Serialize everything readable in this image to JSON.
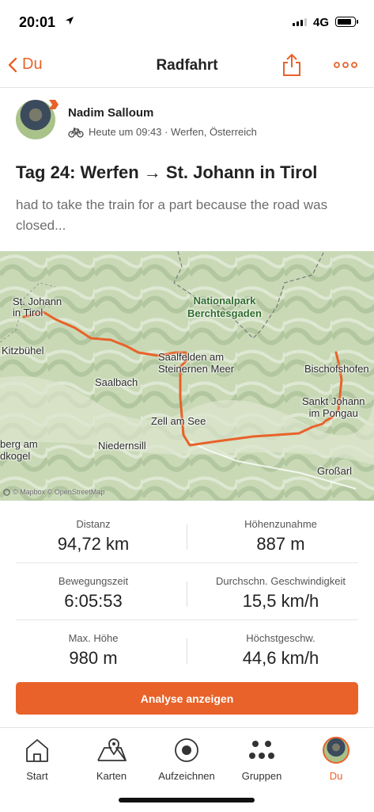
{
  "status_bar": {
    "time": "20:01",
    "network": "4G",
    "battery_level": 0.85
  },
  "nav": {
    "back_label": "Du",
    "title": "Radfahrt",
    "icons": [
      "chevron-left-icon",
      "share-icon",
      "more-icon"
    ]
  },
  "athlete": {
    "name": "Nadim Salloum",
    "meta": "Heute um 09:43 · Werfen, Österreich",
    "activity_icon": "bike-icon"
  },
  "activity": {
    "title": "Tag 24: Werfen → St. Johann in Tirol",
    "description": "had to take the train for a part because the road was closed..."
  },
  "map": {
    "labels": {
      "st_johann_tirol": "St. Johann in Tirol",
      "kitzbuehel": "Kitzbühel",
      "saalbach": "Saalbach",
      "saalfelden": "Saalfelden am Steinernen Meer",
      "zell_am_see": "Zell am See",
      "niedernsill": "Niedernsill",
      "bischofshofen": "Bischofshofen",
      "sankt_johann_pongau": "Sankt Johann im Pongau",
      "grossarl": "Großarl",
      "berg_am_kogel": "Mittersill berg am dkogel",
      "nationalpark": "Nationalpark Berchtesgaden"
    },
    "attribution": "© Mapbox © OpenStreetMap",
    "route_color": "#e8622a"
  },
  "stats": [
    {
      "label": "Distanz",
      "value": "94,72 km"
    },
    {
      "label": "Höhenzunahme",
      "value": "887 m"
    },
    {
      "label": "Bewegungszeit",
      "value": "6:05:53"
    },
    {
      "label": "Durchschn. Geschwindigkeit",
      "value": "15,5 km/h"
    },
    {
      "label": "Max. Höhe",
      "value": "980 m"
    },
    {
      "label": "Höchstgeschw.",
      "value": "44,6 km/h"
    }
  ],
  "analyze_button": "Analyse anzeigen",
  "tabs": [
    {
      "label": "Start",
      "icon": "home-icon"
    },
    {
      "label": "Karten",
      "icon": "map-icon"
    },
    {
      "label": "Aufzeichnen",
      "icon": "record-icon"
    },
    {
      "label": "Gruppen",
      "icon": "groups-icon"
    },
    {
      "label": "Du",
      "icon": "avatar-icon",
      "active": true
    }
  ],
  "colors": {
    "accent": "#e8622a",
    "text": "#222222",
    "muted": "#6e6e6e"
  }
}
